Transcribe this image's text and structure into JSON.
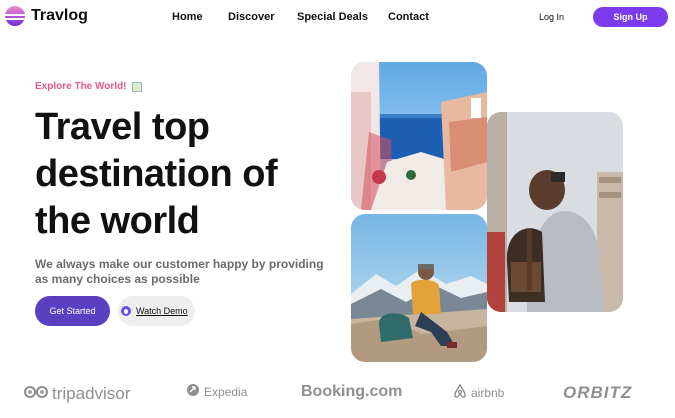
{
  "brand": {
    "name": "Travlog"
  },
  "nav": {
    "links": [
      "Home",
      "Discover",
      "Special Deals",
      "Contact"
    ],
    "login": "Log In",
    "signup": "Sign Up"
  },
  "hero": {
    "eyebrow": "Explore The World!",
    "headline_lines": [
      "Travel top",
      "destination of",
      "the world"
    ],
    "subtext": "We always make our customer happy by providing as many choices as possible",
    "cta_primary": "Get Started",
    "cta_secondary": "Watch Demo"
  },
  "partners": [
    "tripadvisor",
    "Expedia",
    "Booking.com",
    "airbnb",
    "ORBITZ"
  ],
  "icons": {
    "logo": "travlog-logo-icon",
    "play": "play-icon",
    "eyebrow_image": "broken-image-icon"
  },
  "colors": {
    "accent": "#7c3aed",
    "primary_button": "#5a3fc0",
    "eyebrow": "#e5578f",
    "muted_text": "#6b6b6b",
    "partner_logo": "#8f8f8f"
  }
}
